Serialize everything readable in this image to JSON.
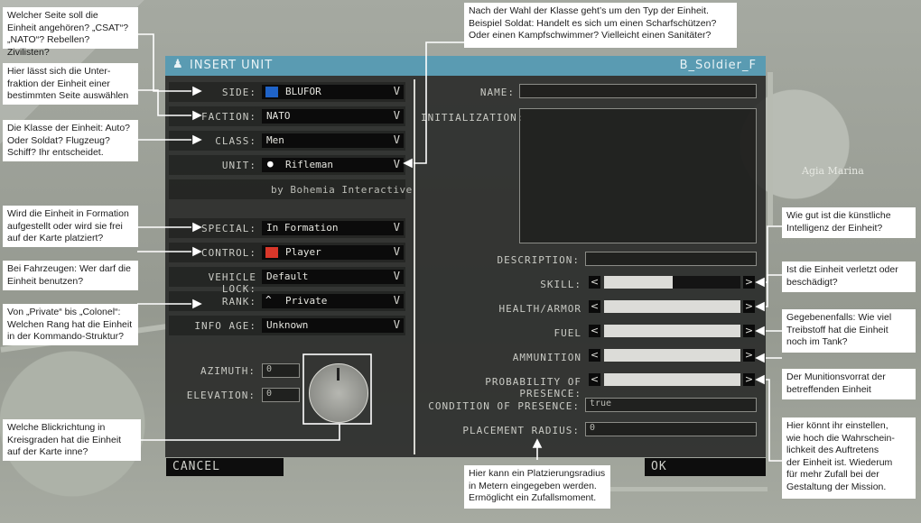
{
  "map": {
    "town_label": "Agia Marina"
  },
  "dialog": {
    "title": "INSERT UNIT",
    "classname": "B_Soldier_F",
    "left": {
      "side": {
        "label": "SIDE:",
        "value": "BLUFOR",
        "color": "#1f63c8"
      },
      "faction": {
        "label": "FACTION:",
        "value": "NATO"
      },
      "class": {
        "label": "CLASS:",
        "value": "Men"
      },
      "unit": {
        "label": "UNIT:",
        "value": "Rifleman",
        "icon": "rifleman-icon"
      },
      "author": "by Bohemia Interactive",
      "special": {
        "label": "SPECIAL:",
        "value": "In Formation"
      },
      "control": {
        "label": "CONTROL:",
        "value": "Player",
        "color": "#d9372a"
      },
      "vehicle_lock": {
        "label": "VEHICLE LOCK:",
        "value": "Default"
      },
      "rank": {
        "label": "RANK:",
        "value": "Private",
        "icon": "private-rank-icon"
      },
      "info_age": {
        "label": "INFO AGE:",
        "value": "Unknown"
      },
      "azimuth": {
        "label": "AZIMUTH:",
        "value": "0"
      },
      "elevation": {
        "label": "ELEVATION:",
        "value": "0"
      }
    },
    "right": {
      "name": {
        "label": "NAME:",
        "value": ""
      },
      "init": {
        "label": "INITIALIZATION:"
      },
      "description": {
        "label": "DESCRIPTION:",
        "value": ""
      },
      "skill": {
        "label": "SKILL:",
        "level": 0.5
      },
      "health": {
        "label": "HEALTH/ARMOR",
        "level": 1.0
      },
      "fuel": {
        "label": "FUEL",
        "level": 1.0
      },
      "ammo": {
        "label": "AMMUNITION",
        "level": 1.0
      },
      "presence": {
        "label": "PROBABILITY OF PRESENCE:",
        "level": 1.0
      },
      "condition": {
        "label": "CONDITION OF PRESENCE:",
        "value": "true"
      },
      "radius": {
        "label": "PLACEMENT RADIUS:",
        "value": "0"
      }
    },
    "cancel": "CANCEL",
    "ok": "OK"
  },
  "callouts": {
    "side": "Welcher Seite soll die\nEinheit angehören? „CSAT“?\n„NATO“? Rebellen? Zivilisten?",
    "faction": "Hier lässt sich die Unter-\nfraktion der Einheit einer\nbestimmten Seite auswählen",
    "class": "Die Klasse der Einheit: Auto?\nOder Soldat? Flugzeug?\nSchiff? Ihr entscheidet.",
    "special": "Wird die Einheit in Formation\naufgestellt oder wird sie frei\nauf der Karte platziert?",
    "vehicle": "Bei Fahrzeugen: Wer darf die\nEinheit benutzen?",
    "rank": "Von „Private“ bis „Colonel“:\nWelchen Rang hat die Einheit\nin der Kommando-Struktur?",
    "azimuth": "Welche Blickrichtung in\nKreisgraden hat die Einheit\nauf der Karte inne?",
    "unit": "Nach der Wahl der Klasse geht’s um den Typ der Einheit.\nBeispiel Soldat: Handelt es sich um einen Scharfschützen?\nOder einen Kampfschwimmer? Vielleicht einen Sanitäter?",
    "skill": "Wie gut ist die künstliche\nIntelligenz der Einheit?",
    "health": "Ist die Einheit verletzt oder\nbeschädigt?",
    "fuel": "Gegebenenfalls: Wie viel\nTreibstoff hat die Einheit\nnoch im Tank?",
    "ammo": "Der Munitionsvorrat der\nbetreffenden Einheit",
    "presence": "Hier könnt ihr einstellen,\nwie hoch die Wahrschein-\nlichkeit des Auftretens\nder Einheit ist. Wiederum\nfür mehr Zufall bei der\nGestaltung der Mission.",
    "radius": "Hier kann ein Platzierungsradius\nin Metern eingegeben werden.\nErmöglicht ein Zufallsmoment."
  }
}
